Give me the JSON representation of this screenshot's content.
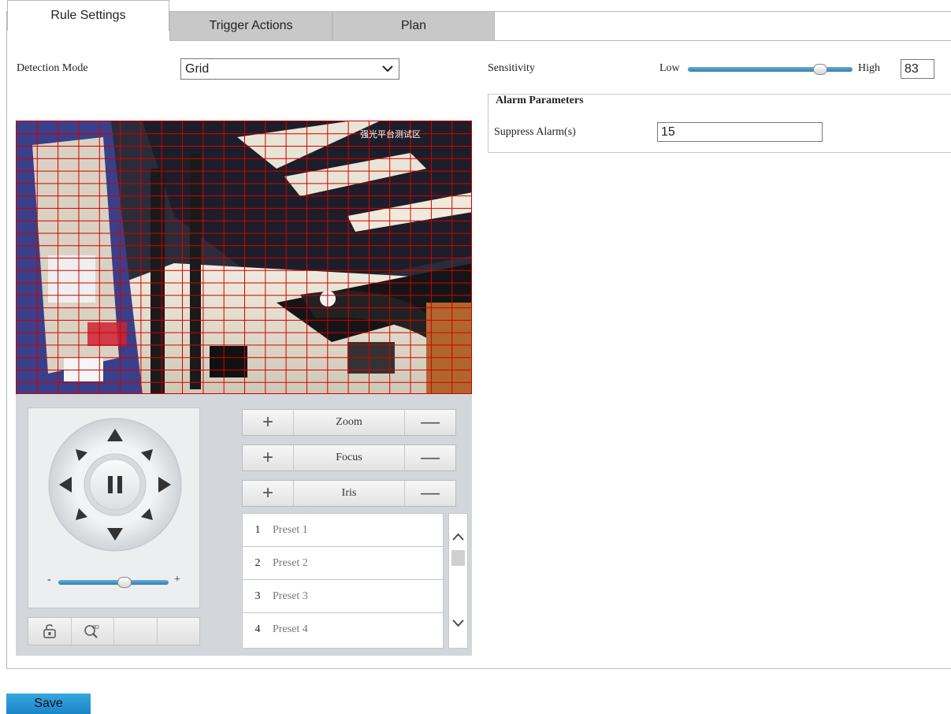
{
  "tabs": [
    {
      "label": "Rule Settings",
      "active": true
    },
    {
      "label": "Trigger Actions",
      "active": false
    },
    {
      "label": "Plan",
      "active": false
    }
  ],
  "detection": {
    "label": "Detection Mode",
    "value": "Grid"
  },
  "sensitivity": {
    "label": "Sensitivity",
    "low": "Low",
    "high": "High",
    "value": "83",
    "level_percent": 83
  },
  "alarm": {
    "legend": "Alarm Parameters",
    "suppress_label": "Suppress Alarm(s)",
    "suppress_value": "15"
  },
  "video": {
    "overlay_text": "强光平台测试区",
    "grid_color": "#d40000"
  },
  "ptz": {
    "speed_minus": "-",
    "speed_plus": "+",
    "speed_level_percent": 60,
    "zoom": "Zoom",
    "focus": "Focus",
    "iris": "Iris",
    "plus": "+",
    "minus": "—"
  },
  "presets": [
    {
      "num": "1",
      "name": "Preset 1"
    },
    {
      "num": "2",
      "name": "Preset 2"
    },
    {
      "num": "3",
      "name": "Preset 3"
    },
    {
      "num": "4",
      "name": "Preset 4"
    }
  ],
  "icons": {
    "dropdown": "chevron-down-icon",
    "up": "arrow-up-icon",
    "pause": "pause-icon",
    "lock": "lock-icon",
    "zoom3d": "3d-zoom-icon"
  },
  "save_label": "Save",
  "colors": {
    "accent": "#2a93d5",
    "tab_inactive": "#c8c8c8",
    "ptz_bg": "#d3d7dc"
  }
}
